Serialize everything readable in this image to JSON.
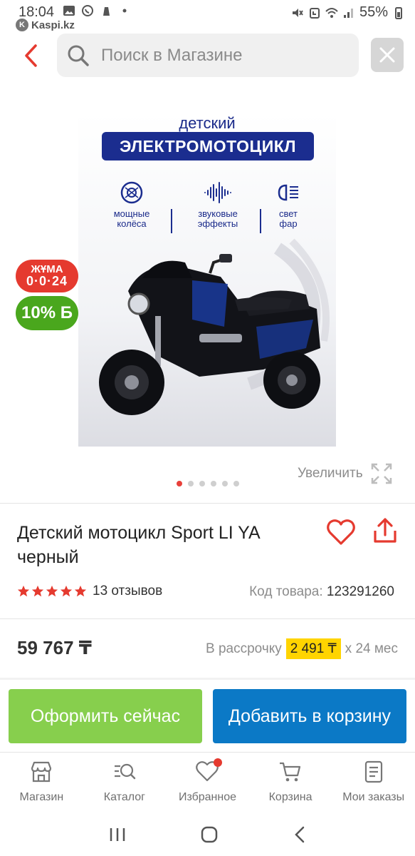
{
  "status_bar": {
    "time": "18:04",
    "battery": "55%",
    "source_app": "Kaspi.kz"
  },
  "search": {
    "placeholder": "Поиск в Магазине"
  },
  "product_image": {
    "kicker": "детский",
    "title": "ЭЛЕКТРОМОТОЦИКЛ",
    "features": [
      {
        "line1": "мощные",
        "line2": "колёса",
        "icon": "wheel-icon"
      },
      {
        "line1": "звуковые",
        "line2": "эффекты",
        "icon": "soundwave-icon"
      },
      {
        "line1": "свет",
        "line2": "фар",
        "icon": "headlight-icon"
      }
    ]
  },
  "badges": {
    "day_line1": "ЖҰМА",
    "day_line2": "0·0·24",
    "bonus": "10% Б"
  },
  "gallery": {
    "zoom_label": "Увеличить",
    "dots_total": 6,
    "active_dot": 0
  },
  "product": {
    "title": "Детский мотоцикл Sport LI YA черный",
    "rating_stars": 5,
    "reviews": "13 отзывов",
    "code_label": "Код товара:",
    "code_value": "123291260",
    "price": "59 767 ₸",
    "installment_prefix": "В рассрочку",
    "installment_amount": "2 491 ₸",
    "installment_suffix": "х 24 мес"
  },
  "actions": {
    "checkout": "Оформить сейчас",
    "add_to_cart": "Добавить в корзину"
  },
  "bottom_nav": [
    {
      "label": "Магазин",
      "icon": "store-icon"
    },
    {
      "label": "Каталог",
      "icon": "catalog-search-icon"
    },
    {
      "label": "Избранное",
      "icon": "heart-icon"
    },
    {
      "label": "Корзина",
      "icon": "cart-icon"
    },
    {
      "label": "Мои заказы",
      "icon": "orders-icon"
    }
  ],
  "colors": {
    "accent_red": "#e53a2f",
    "checkout_green": "#87cf4d",
    "cart_blue": "#0b79c6",
    "installment_yellow": "#ffd400"
  }
}
